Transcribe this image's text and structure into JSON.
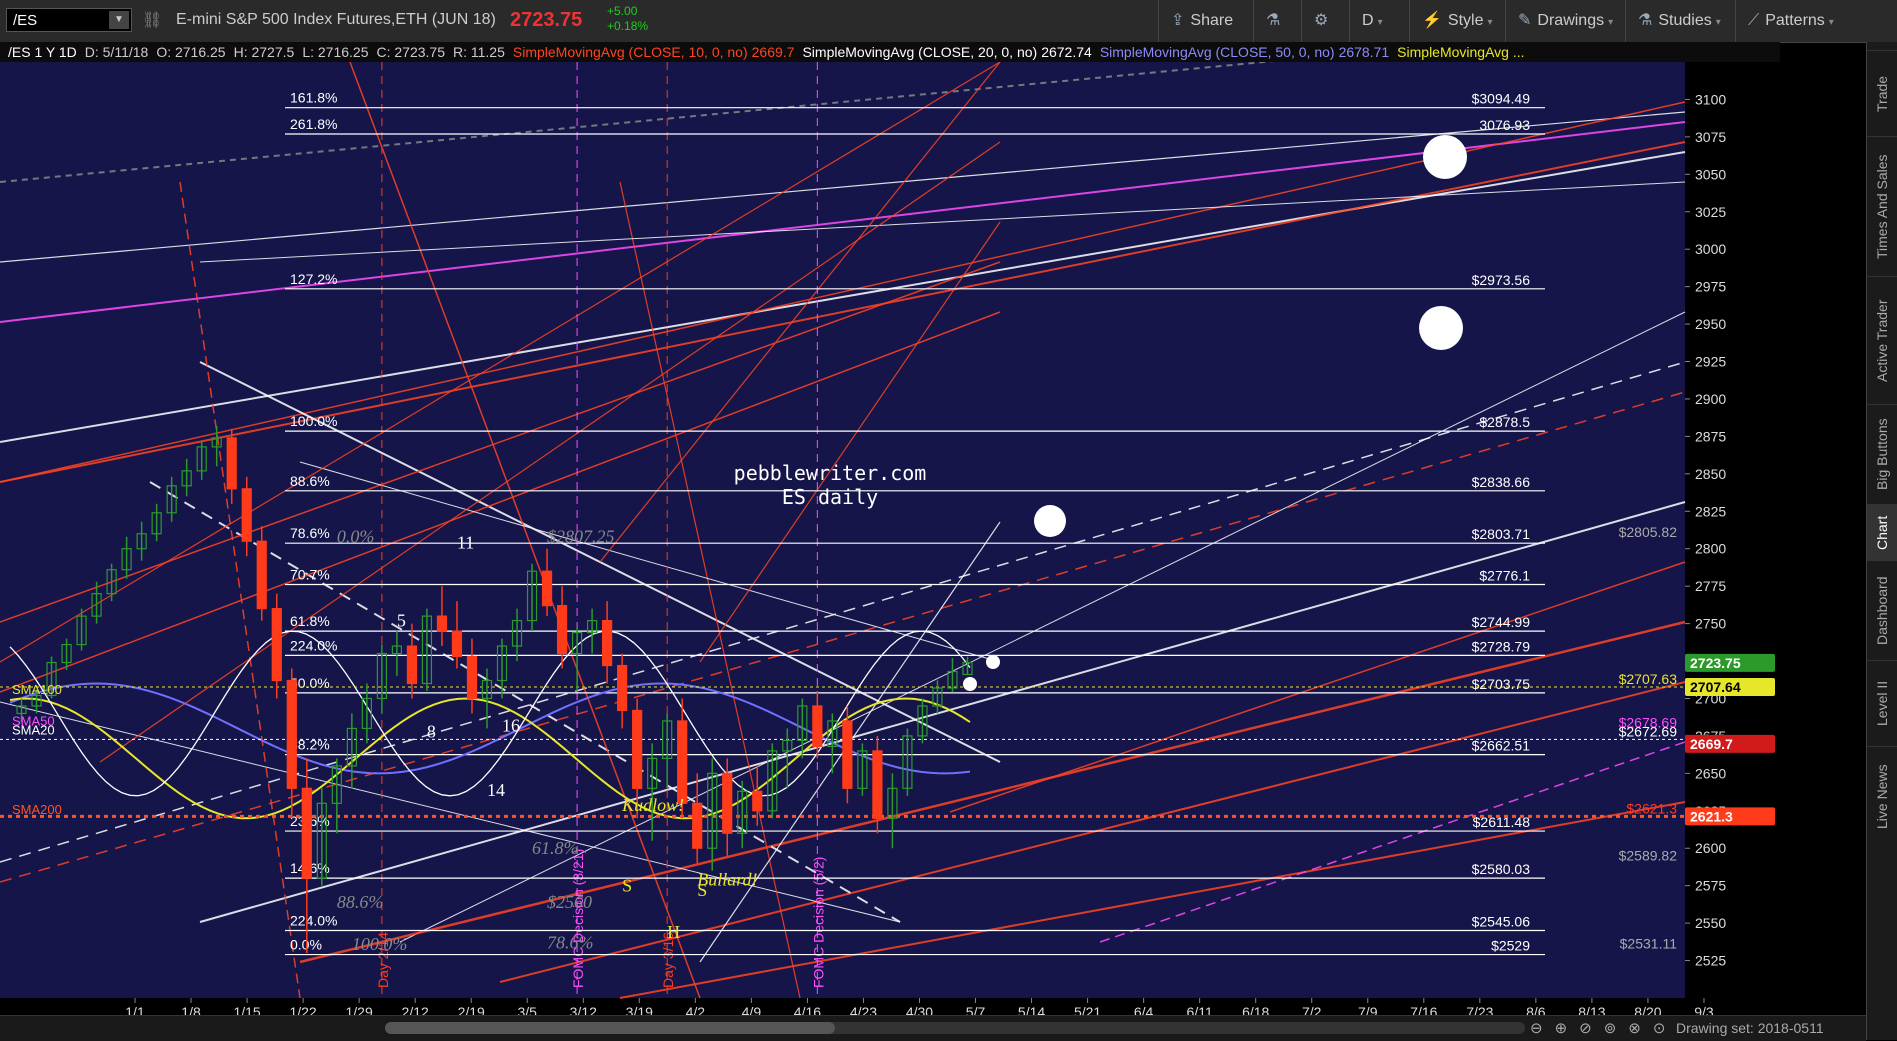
{
  "header": {
    "symbol": "/ES",
    "title": "E-mini S&P 500 Index Futures,ETH (JUN 18)",
    "last": "2723.75",
    "change": "+5.00",
    "change_pct": "+0.18%",
    "toolbar": [
      {
        "label": "Share",
        "icon": "share-icon"
      },
      {
        "label": "",
        "icon": "beaker-icon"
      },
      {
        "label": "",
        "icon": "gear-icon"
      },
      {
        "label": "D",
        "icon": ""
      },
      {
        "label": "Style",
        "icon": "style-icon"
      },
      {
        "label": "Drawings",
        "icon": "pencil-icon"
      },
      {
        "label": "Studies",
        "icon": "beaker-icon"
      },
      {
        "label": "Patterns",
        "icon": "patterns-icon"
      }
    ]
  },
  "studyline": {
    "sym": "/ES 1 Y 1D",
    "date": "D: 5/11/18",
    "open": "O: 2716.25",
    "high": "H: 2727.5",
    "low": "L: 2716.25",
    "close": "C: 2723.75",
    "range": "R: 11.25",
    "sma10": "SimpleMovingAvg (CLOSE, 10, 0, no)",
    "sma10_val": "2669.7",
    "sma20": "SimpleMovingAvg (CLOSE, 20, 0, no)",
    "sma20_val": "2672.74",
    "sma50": "SimpleMovingAvg (CLOSE, 50, 0, no)",
    "sma50_val": "2678.71",
    "sma100": "SimpleMovingAvg ..."
  },
  "sidebar_tabs": [
    "Trade",
    "Times And Sales",
    "Active Trader",
    "Big Buttons",
    "Chart",
    "Dashboard",
    "Level II",
    "Live News"
  ],
  "bottom": {
    "drawing_set": "Drawing set: 2018-0511"
  },
  "colors": {
    "bg": "#15154a",
    "up": "#2b9a2b",
    "down": "#ff3b1a",
    "sma10": "#ff4422",
    "sma20": "#ffffff",
    "sma50": "#7070ff",
    "sma100": "#e6e62a",
    "sma200": "#ff5522",
    "fib": "#ffffff",
    "magenta": "#ff4dff"
  },
  "chart_data": {
    "type": "candlestick",
    "title": "pebblewriter.com ES daily",
    "ylim": [
      2500,
      3125
    ],
    "y_ticks": [
      2525,
      2550,
      2575,
      2600,
      2625,
      2650,
      2675,
      2700,
      2725,
      2750,
      2775,
      2800,
      2825,
      2850,
      2875,
      2900,
      2925,
      2950,
      2975,
      3000,
      3025,
      3050,
      3075,
      3100
    ],
    "x_ticks": [
      "1/1",
      "1/8",
      "1/15",
      "1/22",
      "1/29",
      "2/12",
      "2/19",
      "3/5",
      "3/12",
      "3/19",
      "4/2",
      "4/9",
      "4/16",
      "4/23",
      "4/30",
      "5/7",
      "5/14",
      "5/21",
      "6/4",
      "6/11",
      "6/18",
      "7/2",
      "7/9",
      "7/16",
      "7/23",
      "8/6",
      "8/13",
      "8/20",
      "9/3"
    ],
    "candles": [
      [
        2690,
        2700,
        2684,
        2695
      ],
      [
        2695,
        2706,
        2690,
        2702
      ],
      [
        2702,
        2728,
        2700,
        2724
      ],
      [
        2724,
        2740,
        2719,
        2736
      ],
      [
        2736,
        2760,
        2732,
        2755
      ],
      [
        2755,
        2778,
        2750,
        2770
      ],
      [
        2770,
        2790,
        2765,
        2786
      ],
      [
        2786,
        2808,
        2780,
        2800
      ],
      [
        2800,
        2818,
        2792,
        2810
      ],
      [
        2810,
        2830,
        2805,
        2824
      ],
      [
        2824,
        2848,
        2818,
        2842
      ],
      [
        2842,
        2860,
        2835,
        2852
      ],
      [
        2852,
        2872,
        2846,
        2868
      ],
      [
        2868,
        2882,
        2855,
        2874
      ],
      [
        2874,
        2880,
        2830,
        2840
      ],
      [
        2840,
        2848,
        2795,
        2805
      ],
      [
        2805,
        2815,
        2752,
        2760
      ],
      [
        2760,
        2770,
        2700,
        2712
      ],
      [
        2712,
        2720,
        2620,
        2640
      ],
      [
        2640,
        2660,
        2530,
        2580
      ],
      [
        2580,
        2640,
        2575,
        2630
      ],
      [
        2630,
        2660,
        2610,
        2655
      ],
      [
        2655,
        2690,
        2640,
        2680
      ],
      [
        2680,
        2710,
        2670,
        2700
      ],
      [
        2700,
        2736,
        2690,
        2730
      ],
      [
        2730,
        2745,
        2715,
        2735
      ],
      [
        2735,
        2750,
        2700,
        2710
      ],
      [
        2710,
        2760,
        2705,
        2755
      ],
      [
        2755,
        2775,
        2735,
        2745
      ],
      [
        2745,
        2765,
        2720,
        2728
      ],
      [
        2728,
        2740,
        2690,
        2700
      ],
      [
        2700,
        2720,
        2680,
        2712
      ],
      [
        2712,
        2740,
        2700,
        2735
      ],
      [
        2735,
        2760,
        2725,
        2752
      ],
      [
        2752,
        2790,
        2745,
        2785
      ],
      [
        2785,
        2800,
        2755,
        2762
      ],
      [
        2762,
        2775,
        2720,
        2730
      ],
      [
        2730,
        2748,
        2705,
        2744
      ],
      [
        2744,
        2760,
        2730,
        2752
      ],
      [
        2752,
        2765,
        2710,
        2722
      ],
      [
        2722,
        2730,
        2680,
        2692
      ],
      [
        2692,
        2700,
        2620,
        2640
      ],
      [
        2640,
        2670,
        2605,
        2660
      ],
      [
        2660,
        2690,
        2640,
        2685
      ],
      [
        2685,
        2700,
        2620,
        2630
      ],
      [
        2630,
        2650,
        2590,
        2600
      ],
      [
        2600,
        2660,
        2585,
        2650
      ],
      [
        2650,
        2660,
        2595,
        2610
      ],
      [
        2610,
        2645,
        2600,
        2638
      ],
      [
        2638,
        2655,
        2615,
        2625
      ],
      [
        2625,
        2670,
        2620,
        2665
      ],
      [
        2665,
        2680,
        2640,
        2672
      ],
      [
        2672,
        2700,
        2660,
        2695
      ],
      [
        2695,
        2705,
        2660,
        2668
      ],
      [
        2668,
        2690,
        2650,
        2685
      ],
      [
        2685,
        2695,
        2630,
        2640
      ],
      [
        2640,
        2670,
        2635,
        2665
      ],
      [
        2665,
        2675,
        2610,
        2620
      ],
      [
        2620,
        2650,
        2600,
        2640
      ],
      [
        2640,
        2680,
        2635,
        2675
      ],
      [
        2675,
        2700,
        2670,
        2695
      ],
      [
        2695,
        2712,
        2690,
        2707
      ],
      [
        2707,
        2727,
        2704,
        2718
      ],
      [
        2716,
        2728,
        2716,
        2724
      ]
    ],
    "horizontal_levels": [
      {
        "price": 3094.49,
        "label": "$3094.49",
        "fib": "161.8%"
      },
      {
        "price": 3076.93,
        "label": "3076.93",
        "fib": "261.8%"
      },
      {
        "price": 2973.56,
        "label": "$2973.56",
        "fib": "127.2%"
      },
      {
        "price": 2878.5,
        "label": "$2878.5",
        "fib": "100.0%"
      },
      {
        "price": 2838.66,
        "label": "$2838.66",
        "fib": "88.6%"
      },
      {
        "price": 2803.71,
        "label": "$2803.71",
        "fib": "78.6%"
      },
      {
        "price": 2776.1,
        "label": "$2776.1",
        "fib": "70.7%"
      },
      {
        "price": 2744.99,
        "label": "$2744.99",
        "fib": "61.8%"
      },
      {
        "price": 2728.79,
        "label": "$2728.79",
        "fib": "224.0%"
      },
      {
        "price": 2703.75,
        "label": "$2703.75",
        "fib": "50.0%"
      },
      {
        "price": 2662.51,
        "label": "$2662.51",
        "fib": "38.2%"
      },
      {
        "price": 2611.48,
        "label": "$2611.48",
        "fib": "23.6%"
      },
      {
        "price": 2580.03,
        "label": "$2580.03",
        "fib": "14.6%"
      },
      {
        "price": 2545.06,
        "label": "$2545.06",
        "fib": "224.0%"
      },
      {
        "price": 2529,
        "label": "$2529",
        "fib": "0.0%"
      }
    ],
    "right_price_labels": [
      {
        "price": 2805.82,
        "label": "$2805.82",
        "color": "#aaaaaa"
      },
      {
        "price": 2707.63,
        "label": "$2707.63",
        "color": "#e6e62a"
      },
      {
        "price": 2678.69,
        "label": "$2678.69",
        "color": "#ff4dff"
      },
      {
        "price": 2672.69,
        "label": "$2672.69",
        "color": "#ffffff"
      },
      {
        "price": 2621.3,
        "label": "$2621.3",
        "color": "#ff3b1a"
      },
      {
        "price": 2589.82,
        "label": "$2589.82",
        "color": "#aaaaaa"
      },
      {
        "price": 2531.11,
        "label": "$2531.11",
        "color": "#aaaaaa"
      }
    ],
    "axis_badges": [
      {
        "price": 2723.75,
        "label": "2723.75",
        "bg": "#2b9a2b"
      },
      {
        "price": 2707.64,
        "label": "2707.64",
        "bg": "#e6e62a"
      },
      {
        "price": 2669.7,
        "label": "2669.7",
        "bg": "#d11a1a"
      },
      {
        "price": 2621.3,
        "label": "2621.3",
        "bg": "#ff3b1a"
      }
    ],
    "sma_labels": [
      {
        "price": 2703,
        "label": "SMA100",
        "color": "#e6e62a"
      },
      {
        "price": 2682,
        "label": "SMA50",
        "color": "#ff4dff"
      },
      {
        "price": 2676,
        "label": "SMA20",
        "color": "#ffffff"
      },
      {
        "price": 2623,
        "label": "SMA200",
        "color": "#ff5522"
      }
    ],
    "annotations": [
      {
        "text": "11",
        "x_idx": 29,
        "price": 2800,
        "color": "#ffffff"
      },
      {
        "text": "5",
        "x_idx": 25,
        "price": 2748,
        "color": "#ffffff"
      },
      {
        "text": "8",
        "x_idx": 27,
        "price": 2674,
        "color": "#ffffff"
      },
      {
        "text": "16",
        "x_idx": 32,
        "price": 2678,
        "color": "#ffffff"
      },
      {
        "text": "14",
        "x_idx": 31,
        "price": 2635,
        "color": "#ffffff"
      },
      {
        "text": "S",
        "x_idx": 40,
        "price": 2571,
        "color": "#e6e62a"
      },
      {
        "text": "S",
        "x_idx": 45,
        "price": 2568,
        "color": "#e6e62a"
      },
      {
        "text": "H",
        "x_idx": 43,
        "price": 2540,
        "color": "#e6e62a"
      },
      {
        "text": "Kudlow!",
        "x_idx": 40,
        "price": 2625,
        "color": "#e6e62a"
      },
      {
        "text": "Bullard!",
        "x_idx": 45,
        "price": 2575,
        "color": "#e6e62a"
      },
      {
        "text": "0.0%",
        "x_idx": 21,
        "price": 2804,
        "color": "#888888"
      },
      {
        "text": "$2807.25",
        "x_idx": 35,
        "price": 2804,
        "color": "#888888"
      },
      {
        "text": "61.8%",
        "x_idx": 34,
        "price": 2596,
        "color": "#888888"
      },
      {
        "text": "$2560",
        "x_idx": 35,
        "price": 2560,
        "color": "#888888"
      },
      {
        "text": "88.6%",
        "x_idx": 21,
        "price": 2560,
        "color": "#888888"
      },
      {
        "text": "100.0%",
        "x_idx": 22,
        "price": 2532,
        "color": "#888888"
      },
      {
        "text": "78.6%",
        "x_idx": 35,
        "price": 2533,
        "color": "#888888"
      }
    ],
    "vertical_markers": [
      {
        "x_idx": 37,
        "label": "FOMC Decision (3/21)",
        "color": "#ff4dff"
      },
      {
        "x_idx": 53,
        "label": "FOMC Decision (5/2)",
        "color": "#ff4dff"
      },
      {
        "x_idx": 24,
        "label": "Day 2/14",
        "color": "#ff3b1a"
      },
      {
        "x_idx": 43,
        "label": "Day 3/16",
        "color": "#ff3b1a"
      }
    ]
  }
}
